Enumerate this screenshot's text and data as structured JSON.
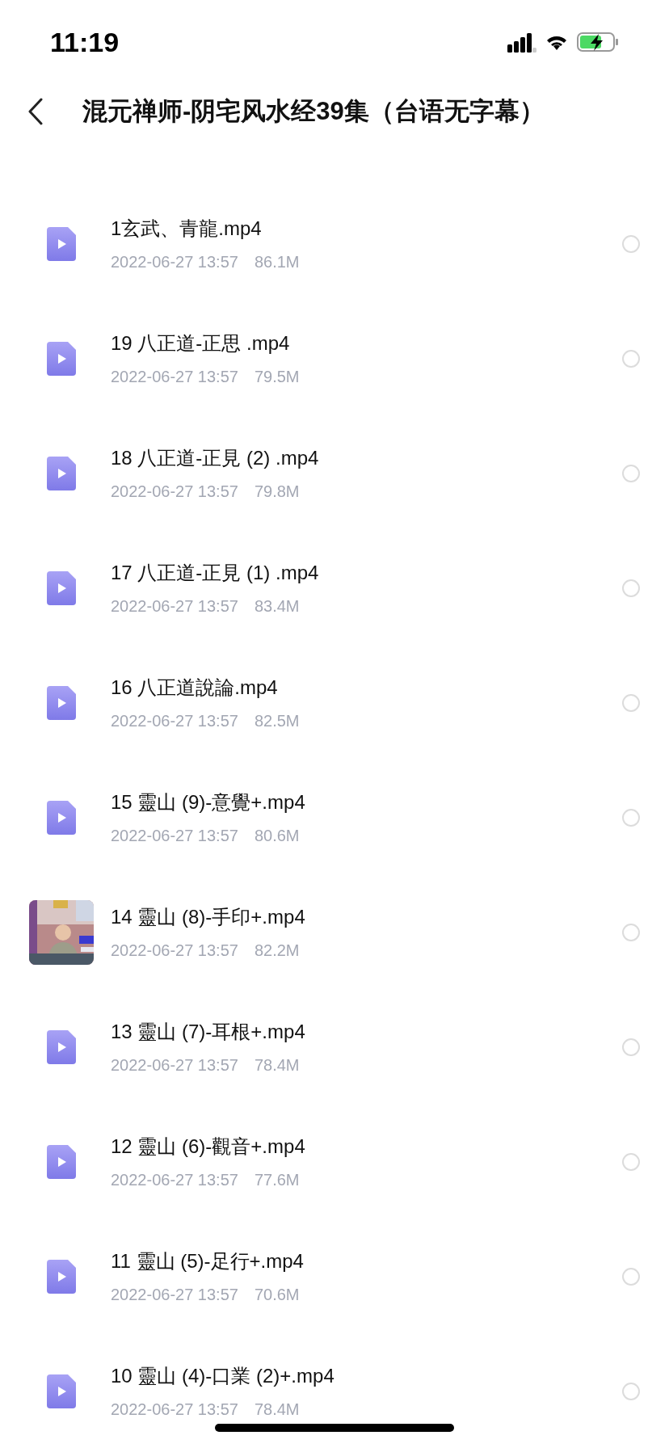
{
  "status_bar": {
    "time": "11:19"
  },
  "header": {
    "title": "混元禅师-阴宅风水经39集（台语无字幕）"
  },
  "files": [
    {
      "kind": "video",
      "name": "1玄武、青龍.mp4",
      "date": "2022-06-27 13:57",
      "size": "86.1M",
      "selected": false
    },
    {
      "kind": "video",
      "name": "19 八正道-正思 .mp4",
      "date": "2022-06-27 13:57",
      "size": "79.5M",
      "selected": false
    },
    {
      "kind": "video",
      "name": "18 八正道-正見 (2) .mp4",
      "date": "2022-06-27 13:57",
      "size": "79.8M",
      "selected": false
    },
    {
      "kind": "video",
      "name": "17 八正道-正見 (1) .mp4",
      "date": "2022-06-27 13:57",
      "size": "83.4M",
      "selected": false
    },
    {
      "kind": "video",
      "name": "16 八正道說論.mp4",
      "date": "2022-06-27 13:57",
      "size": "82.5M",
      "selected": false
    },
    {
      "kind": "video",
      "name": "15 靈山 (9)-意覺+.mp4",
      "date": "2022-06-27 13:57",
      "size": "80.6M",
      "selected": false
    },
    {
      "kind": "thumbnail",
      "name": "14 靈山 (8)-手印+.mp4",
      "date": "2022-06-27 13:57",
      "size": "82.2M",
      "selected": false
    },
    {
      "kind": "video",
      "name": "13 靈山 (7)-耳根+.mp4",
      "date": "2022-06-27 13:57",
      "size": "78.4M",
      "selected": false
    },
    {
      "kind": "video",
      "name": "12 靈山 (6)-觀音+.mp4",
      "date": "2022-06-27 13:57",
      "size": "77.6M",
      "selected": false
    },
    {
      "kind": "video",
      "name": "11 靈山 (5)-足行+.mp4",
      "date": "2022-06-27 13:57",
      "size": "70.6M",
      "selected": false
    },
    {
      "kind": "video",
      "name": "10 靈山 (4)-口業 (2)+.mp4",
      "date": "2022-06-27 13:57",
      "size": "78.4M",
      "selected": false
    }
  ]
}
